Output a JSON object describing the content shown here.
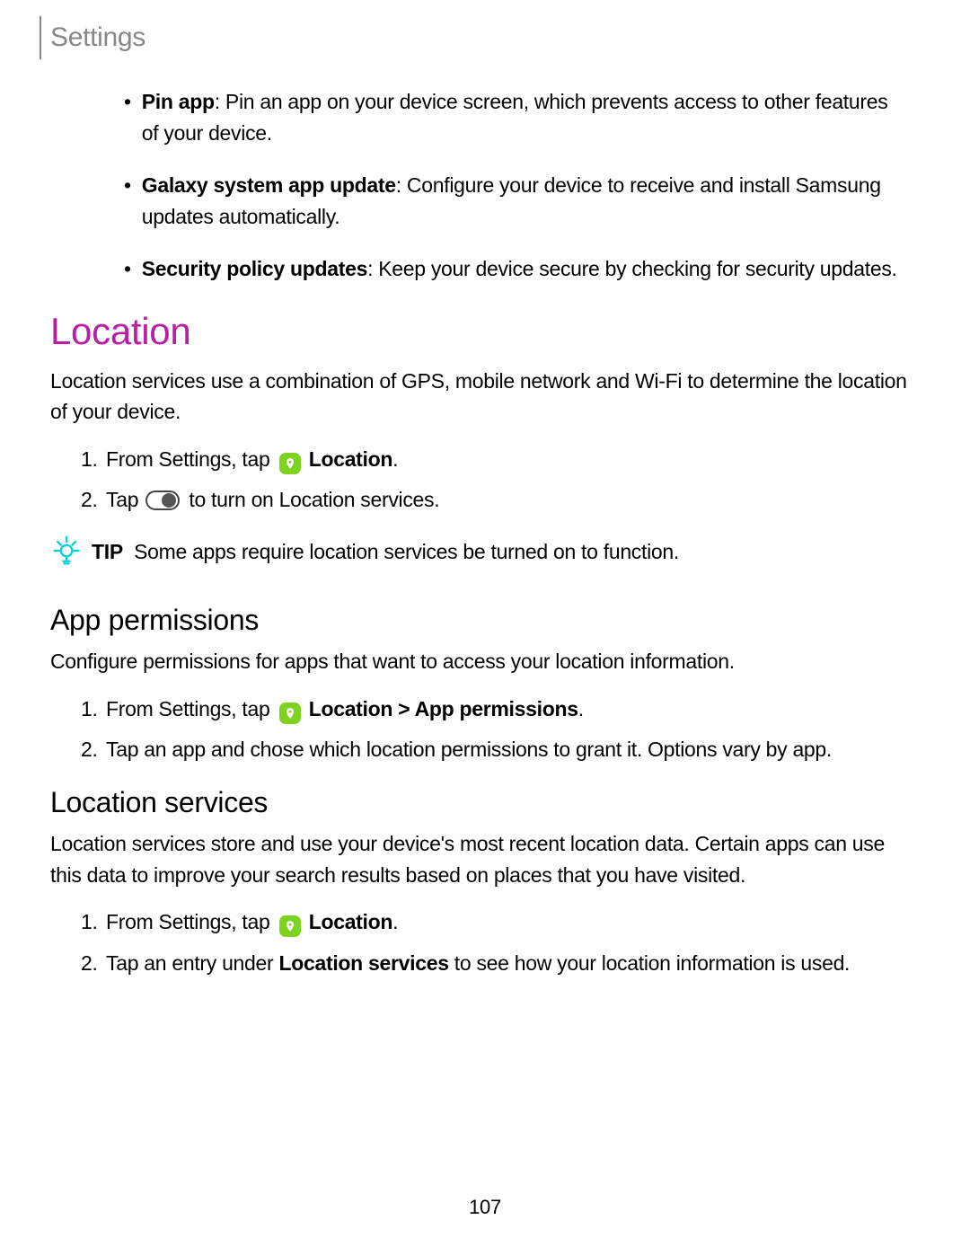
{
  "header": {
    "title": "Settings"
  },
  "bullets": [
    {
      "title": "Pin app",
      "desc": ": Pin an app on your device screen, which prevents access to other features of your device."
    },
    {
      "title": "Galaxy system app update",
      "desc": ": Configure your device to receive and install Samsung updates automatically."
    },
    {
      "title": "Security policy updates",
      "desc": ": Keep your device secure by checking for security updates."
    }
  ],
  "location": {
    "heading": "Location",
    "desc": "Location services use a combination of GPS, mobile network and Wi-Fi to determine the location of your device.",
    "steps": {
      "s1a": "From Settings, tap",
      "s1b": "Location",
      "s2a": "Tap",
      "s2b": "to turn on Location services."
    },
    "tip_label": "TIP",
    "tip_text": "Some apps require location services be turned on to function."
  },
  "app_perm": {
    "heading": "App permissions",
    "desc": "Configure permissions for apps that want to access your location information.",
    "steps": {
      "s1a": "From Settings, tap",
      "s1b": "Location > App permissions",
      "s2": "Tap an app and chose which location permissions to grant it. Options vary by app."
    }
  },
  "loc_services": {
    "heading": "Location services",
    "desc": "Location services store and use your device's most recent location data. Certain apps can use this data to improve your search results based on places that you have visited.",
    "steps": {
      "s1a": "From Settings, tap",
      "s1b": "Location",
      "s2a": "Tap an entry under ",
      "s2b": "Location services",
      "s2c": " to see how your location information is used."
    }
  },
  "page_number": "107"
}
